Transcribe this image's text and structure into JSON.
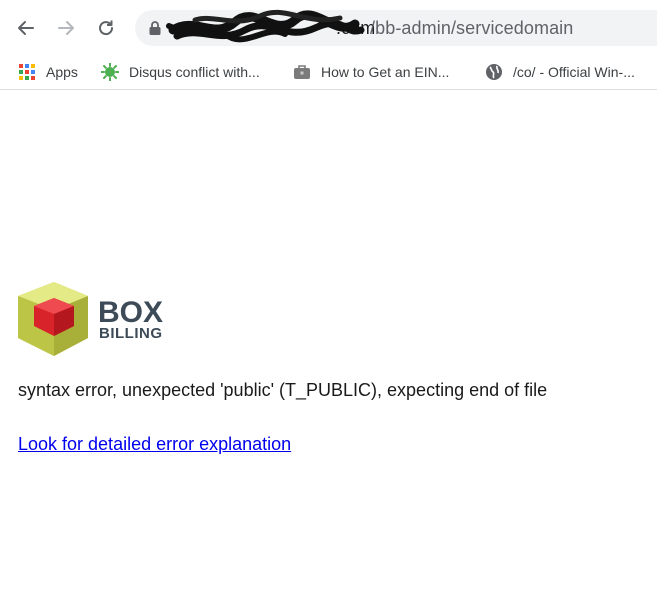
{
  "browser": {
    "url_host_visible": ".com",
    "url_path": "/bb-admin/servicedomain"
  },
  "bookmarks": [
    {
      "label": "Apps",
      "icon": "apps-grid-icon"
    },
    {
      "label": "Disqus conflict with...",
      "icon": "green-gear-icon"
    },
    {
      "label": "How to Get an EIN...",
      "icon": "briefcase-icon"
    },
    {
      "label": "/co/ - Official Win-...",
      "icon": "globe-icon"
    }
  ],
  "logo": {
    "line1": "BOX",
    "line2": "BILLING"
  },
  "error": {
    "message": "syntax error, unexpected 'public' (T_PUBLIC), expecting end of file",
    "link_text": "Look for detailed error explanation"
  },
  "colors": {
    "link": "#0000ee",
    "logo_text": "#3d4a57",
    "cube_yellow": "#c9d44a",
    "cube_red": "#d8232a"
  }
}
